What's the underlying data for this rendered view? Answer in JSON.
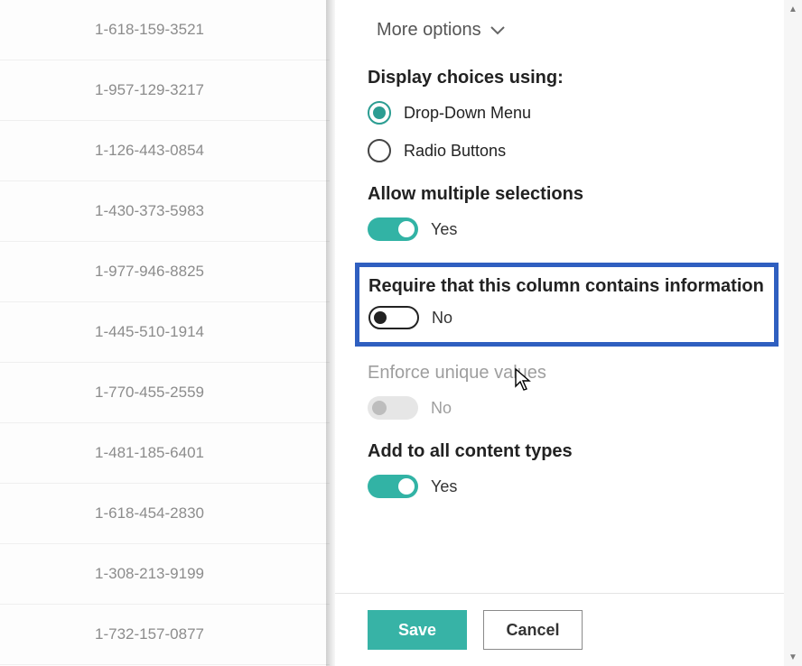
{
  "list": {
    "rows": [
      "1-618-159-3521",
      "1-957-129-3217",
      "1-126-443-0854",
      "1-430-373-5983",
      "1-977-946-8825",
      "1-445-510-1914",
      "1-770-455-2559",
      "1-481-185-6401",
      "1-618-454-2830",
      "1-308-213-9199",
      "1-732-157-0877"
    ]
  },
  "panel": {
    "more_options": "More options",
    "display_heading": "Display choices using:",
    "radio_dropdown": "Drop-Down Menu",
    "radio_radio": "Radio Buttons",
    "allow_multi_heading": "Allow multiple selections",
    "allow_multi_value": "Yes",
    "require_heading": "Require that this column contains information",
    "require_value": "No",
    "unique_heading": "Enforce unique values",
    "unique_value": "No",
    "content_types_heading": "Add to all content types",
    "content_types_value": "Yes"
  },
  "footer": {
    "save": "Save",
    "cancel": "Cancel"
  },
  "colors": {
    "accent": "#32b3a5",
    "highlight": "#2f5fc0"
  }
}
